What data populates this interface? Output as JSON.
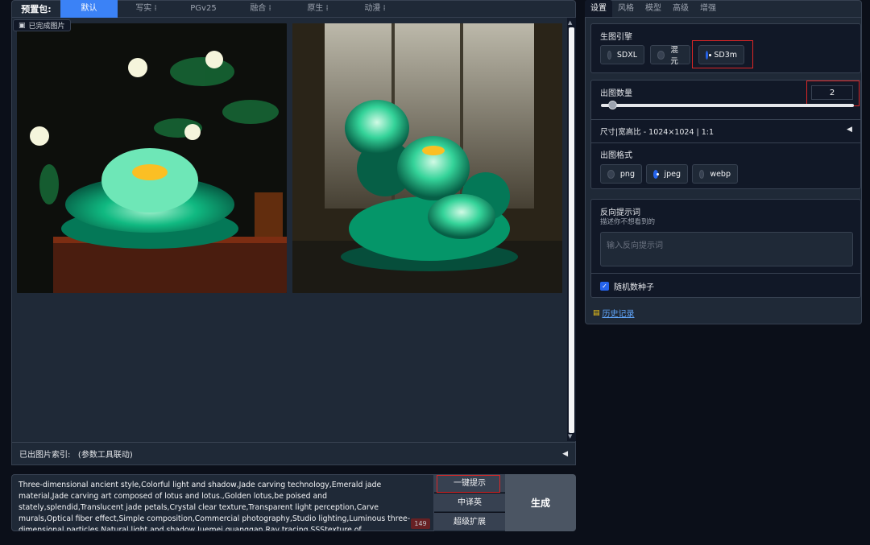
{
  "presets": {
    "label": "预置包:",
    "tabs": [
      "默认",
      "写实",
      "PGv25",
      "融合",
      "原生",
      "动漫"
    ],
    "active_index": 0
  },
  "gallery": {
    "done_badge": "已完成图片",
    "index_label": "已出图片索引:",
    "index_hint": "(参数工具联动)"
  },
  "prompt": {
    "text": "Three-dimensional ancient style,Colorful light and shadow,Jade carving technology,Emerald jade material,Jade carving art composed of lotus and lotus.,Golden lotus,be poised and stately,splendid,Translucent jade petals,Crystal clear texture,Transparent light perception,Carve murals,Optical fiber effect,Simple composition,Commercial photography,Studio lighting,Luminous three-dimensional particles,Natural light and shadow,Juemei guanggan,Ray tracing,SSStexture of wood,subsurface scattering,Biological luminescence,Volume light,Central luminescence,contour light,Light",
    "char_count": "149",
    "btn_one_click": "一键提示",
    "btn_translate": "中译英",
    "btn_expand": "超级扩展",
    "btn_generate": "生成"
  },
  "settings": {
    "tabs": [
      "设置",
      "风格",
      "模型",
      "高级",
      "增强"
    ],
    "engine": {
      "title": "生图引擎",
      "options": [
        "SDXL",
        "混元",
        "SD3m"
      ],
      "selected": "SD3m"
    },
    "count": {
      "title": "出图数量",
      "value": "2",
      "slider_fraction": 0.02
    },
    "size": {
      "label": "尺寸|宽高比 - 1024×1024 | 1:1"
    },
    "format": {
      "title": "出图格式",
      "options": [
        "png",
        "jpeg",
        "webp"
      ],
      "selected": "jpeg"
    },
    "negative": {
      "title": "反向提示词",
      "subtitle": "描述你不想看到的",
      "placeholder": "输入反向提示词"
    },
    "random_seed": {
      "label": "随机数种子",
      "checked": true
    },
    "history": "历史记录"
  },
  "colors": {
    "accent": "#3b82f6",
    "highlight": "#dc2626",
    "jade": "#34d399"
  }
}
